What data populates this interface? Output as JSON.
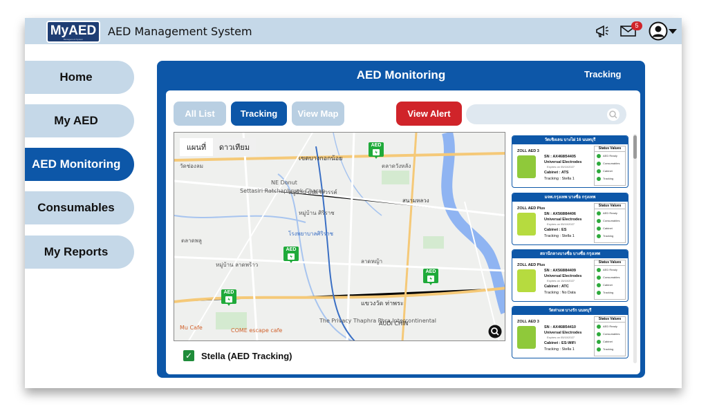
{
  "header": {
    "logo_text": "MyAED",
    "logo_sub": "Management System",
    "title": "AED Management System",
    "notification_count": "5"
  },
  "sidebar": {
    "items": [
      {
        "label": "Home"
      },
      {
        "label": "My AED"
      },
      {
        "label": "AED Monitoring"
      },
      {
        "label": "Consumables"
      },
      {
        "label": "My Reports"
      }
    ],
    "active_index": 2
  },
  "panel": {
    "title": "AED Monitoring",
    "right_label": "Tracking"
  },
  "toolbar": {
    "all_list": "All List",
    "tracking": "Tracking",
    "view_map": "View Map",
    "view_alert": "View Alert"
  },
  "map": {
    "tab_map": "แผนที่",
    "tab_satellite": "ดาวเทียม",
    "marker_label": "AED",
    "labels": [
      "วัดช่องลม",
      "เขตบางกอกน้อย",
      "ตลาดวังหลัง",
      "หมู่บ้าน บุปผาสวรรค์",
      "หมู่บ้าน ศิริราช",
      "โรงพยาบาลศิริราช",
      "ตลาดพลู",
      "แขวงวัด ท่าพระ",
      "The Privacy Thaphra Phra Intercontinental",
      "Mu Cafe",
      "COME escape cafe",
      "AUDI CHIN",
      "Settasiri Ratchaphruek-Charan",
      "NE Donut",
      "สนามหลวง",
      "หมู่บ้าน ลาดพร้าว",
      "ลาดหญ้า"
    ]
  },
  "colors": {
    "brand": "#0d57a8",
    "alert": "#d0242a",
    "topbar": "#c5d8e8",
    "ok": "#2eaa3c"
  },
  "devices": [
    {
      "location": "วัดเชิงเลน บางไผ่ 16 นนทบุรี",
      "model": "ZOLL AED 3",
      "sn": "SN : AX468I54405",
      "electrodes": "Universal Electrodes",
      "expires": "Expires on 05/10/2027",
      "cabinet": "Cabinet : ATS",
      "tracking": "Tracking : Stella 1",
      "device_color": "#8fc93a"
    },
    {
      "location": "มจพ.กรุงเทพ บางซื่อ กรุงเทพ",
      "model": "ZOLL AED Plus",
      "sn": "SN : AX568I84406",
      "electrodes": "Universal Electrodes",
      "expires": "Expires on 05/10/2027",
      "cabinet": "Cabinet : ES",
      "tracking": "Tracking : Stella 1",
      "device_color": "#b6db3f"
    },
    {
      "location": "สถานีกลางบางซื่อ บางซื่อ กรุงเทพ",
      "model": "ZOLL AED Plus",
      "sn": "SN : AX568I84409",
      "electrodes": "Universal Electrodes",
      "expires": "Expires on 15/10/2027",
      "cabinet": "Cabinet : ATC",
      "tracking": "Tracking : No Data",
      "device_color": "#b6db3f"
    },
    {
      "location": "วัดท่าแพ บางรัก นนทบุรี",
      "model": "ZOLL AED 3",
      "sn": "SN : AX468I54410",
      "electrodes": "Universal Electrodes",
      "expires": "Expires on 05/10/2027",
      "cabinet": "Cabinet : ES-WiFi",
      "tracking": "Tracking : Stella 1",
      "device_color": "#8fc93a"
    }
  ],
  "status_values": {
    "title": "Status Values",
    "items": [
      "AED Ready",
      "Consumables",
      "Cabinet",
      "Tracking"
    ]
  },
  "footer": {
    "checkbox_label": "Stella (AED Tracking)",
    "checked": true
  }
}
